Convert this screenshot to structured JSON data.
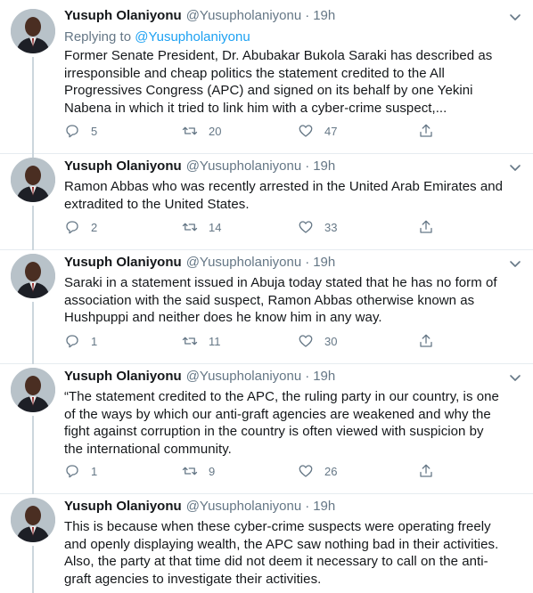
{
  "tweets": [
    {
      "name": "Yusuph Olaniyonu",
      "handle": "@Yusupholaniyonu",
      "time": "19h",
      "replying_prefix": "Replying to",
      "replying_handle": "@Yusupholaniyonu",
      "lines": [
        "Former Senate President, Dr. Abubakar Bukola Saraki has described as",
        "irresponsible and cheap politics the statement credited to the All",
        "Progressives Congress (APC) and signed on its behalf by one Yekini",
        "Nabena in which it tried to link him with a cyber-crime suspect,..."
      ],
      "replies": "5",
      "retweets": "20",
      "likes": "47"
    },
    {
      "name": "Yusuph Olaniyonu",
      "handle": "@Yusupholaniyonu",
      "time": "19h",
      "lines": [
        "Ramon Abbas who was recently arrested in the United Arab Emirates and",
        "extradited to the United States."
      ],
      "replies": "2",
      "retweets": "14",
      "likes": "33"
    },
    {
      "name": "Yusuph Olaniyonu",
      "handle": "@Yusupholaniyonu",
      "time": "19h",
      "lines": [
        "Saraki in a statement issued in Abuja today stated that he has no form of",
        "association with the said suspect, Ramon Abbas otherwise known as",
        "Hushpuppi and neither does he know him in any way."
      ],
      "replies": "1",
      "retweets": "11",
      "likes": "30"
    },
    {
      "name": "Yusuph Olaniyonu",
      "handle": "@Yusupholaniyonu",
      "time": "19h",
      "lines": [
        "“The statement credited to the APC, the ruling party in our country, is one",
        "of the ways by which our anti-graft agencies are weakened and why the",
        "fight against corruption in the country is often viewed with suspicion by",
        "the international community."
      ],
      "replies": "1",
      "retweets": "9",
      "likes": "26"
    },
    {
      "name": "Yusuph Olaniyonu",
      "handle": "@Yusupholaniyonu",
      "time": "19h",
      "lines": [
        "This is because when these cyber-crime suspects were operating freely",
        "and openly displaying wealth, the APC saw nothing bad in their activities.",
        "Also, the party at that time did not deem it necessary to call on the anti-",
        "graft agencies to investigate their activities."
      ]
    }
  ],
  "colors": {
    "link": "#1da1f2",
    "muted": "#657786",
    "text": "#14171a",
    "divider": "#e6ecf0"
  },
  "icons": {
    "reply": "reply-icon",
    "retweet": "retweet-icon",
    "like": "heart-icon",
    "share": "share-icon",
    "caret": "chevron-down-icon"
  }
}
